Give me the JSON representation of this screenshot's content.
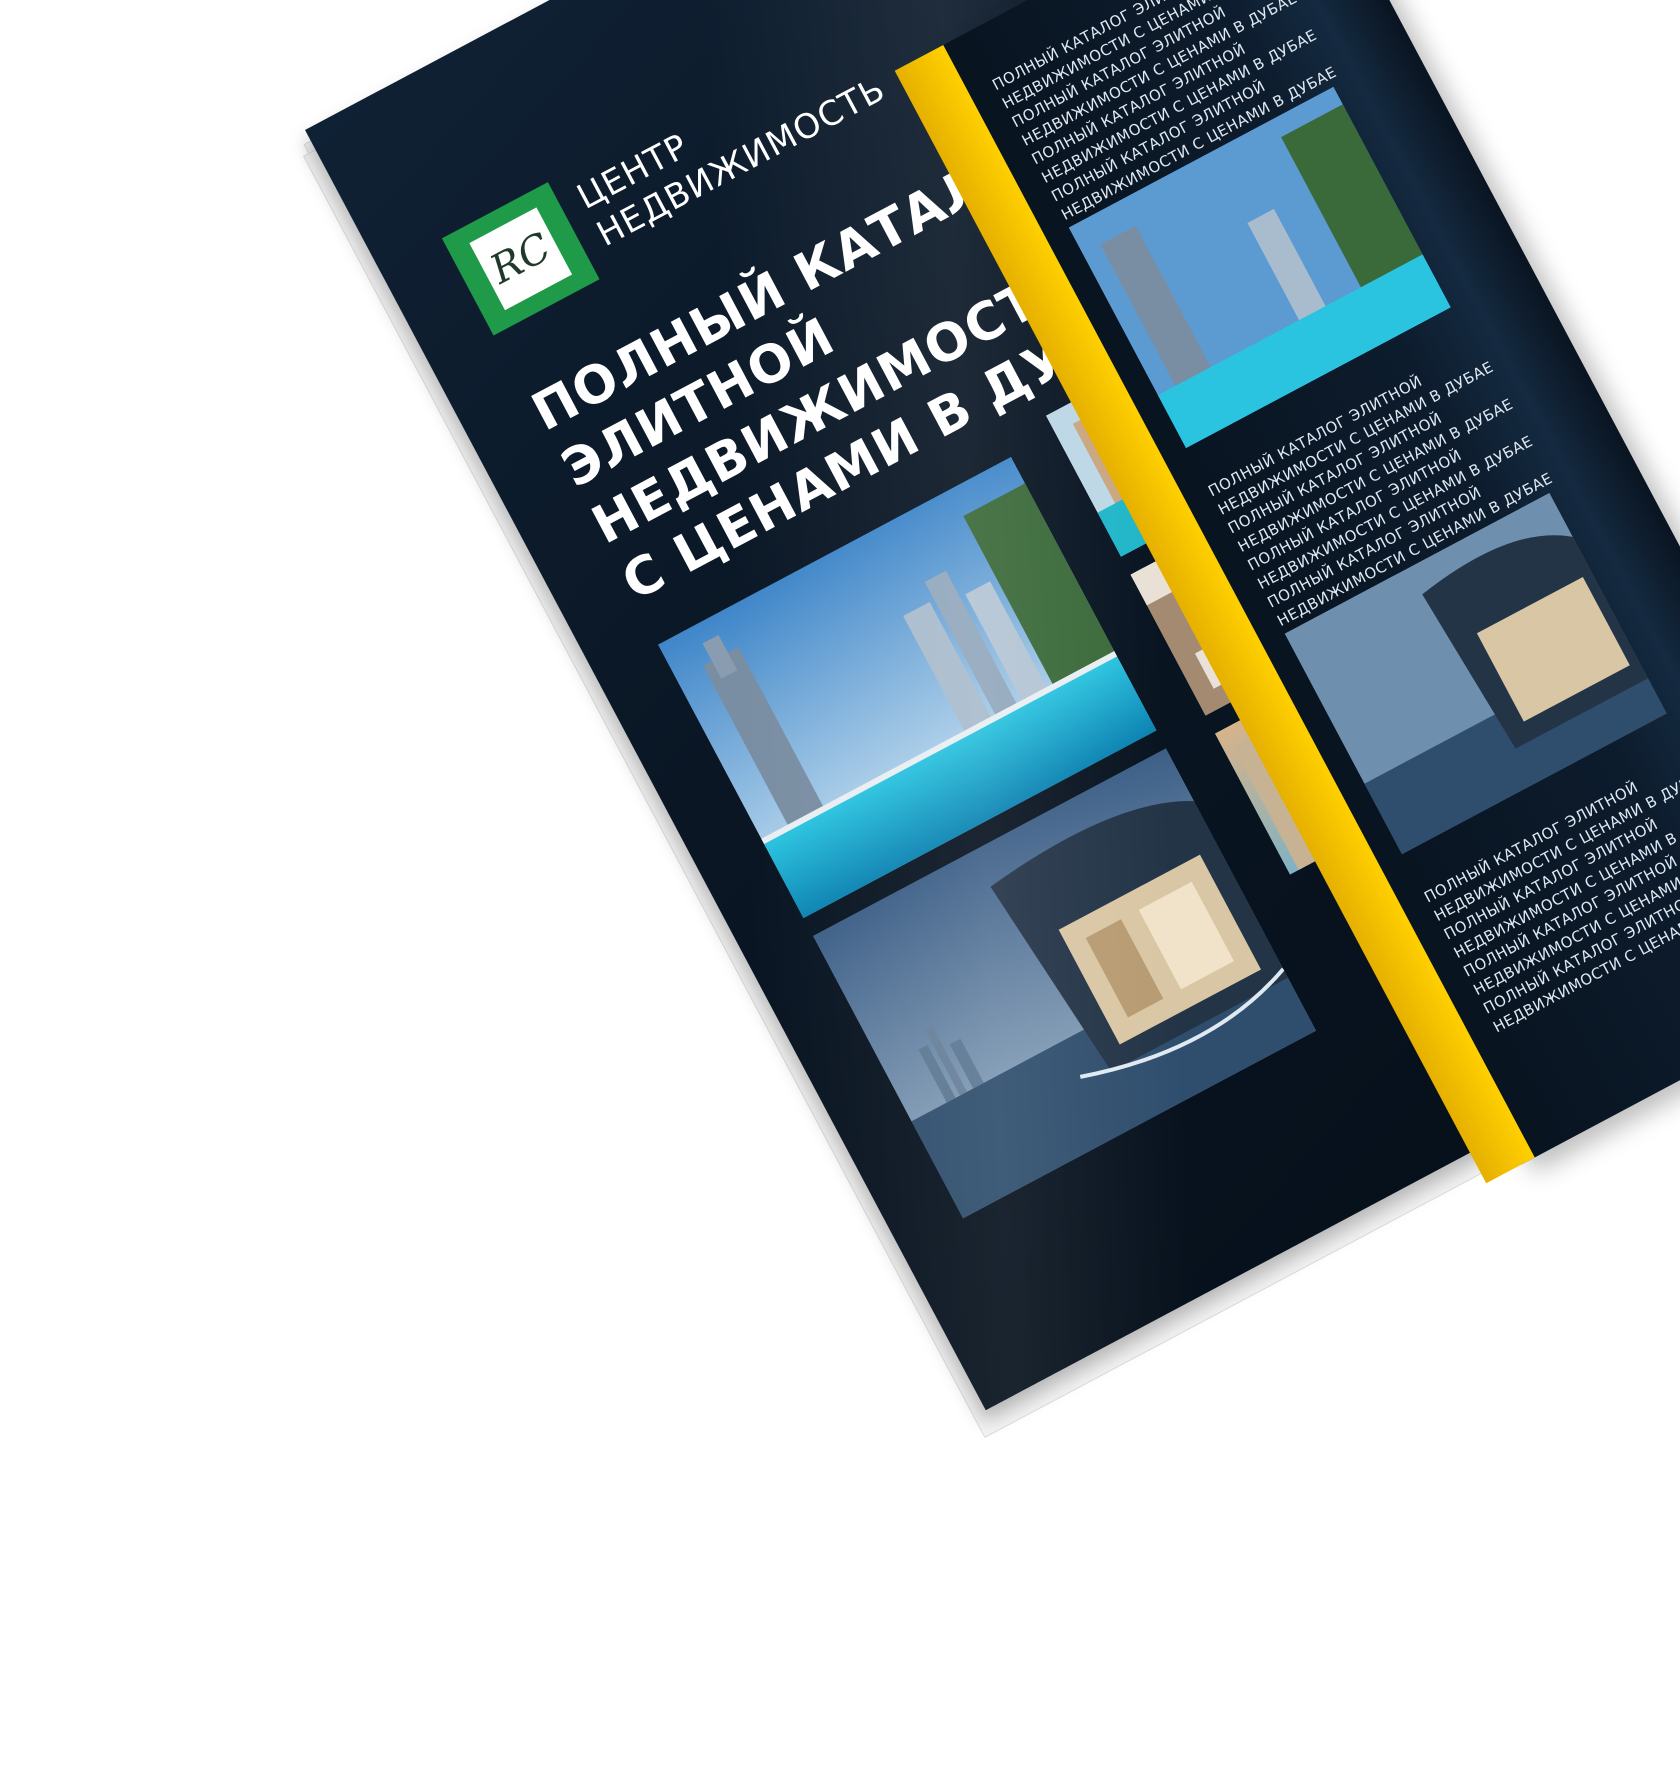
{
  "brand": {
    "logo_monogram": "RC",
    "name_line1": "ЦЕНТР",
    "name_line2": "НЕДВИЖИМОСТЬ"
  },
  "headline": {
    "line1": "ПОЛНЫЙ КАТАЛОГ",
    "line2": "ЭЛИТНОЙ НЕДВИЖИМОСТИ",
    "line3": "С ЦЕНАМИ В ДУБАЕ"
  },
  "right_page": {
    "paragraphs": [
      "ПОЛНЫЙ КАТАЛОГ ЭЛИТНОЙ НЕДВИЖИМОСТИ С ЦЕНАМИ В ДУБАЕ ПОЛНЫЙ КАТАЛОГ ЭЛИТНОЙ НЕДВИЖИМОСТИ С ЦЕНАМИ В ДУБАЕ ПОЛНЫЙ КАТАЛОГ ЭЛИТНОЙ НЕДВИЖИМОСТИ С ЦЕНАМИ В ДУБАЕ ПОЛНЫЙ КАТАЛОГ ЭЛИТНОЙ НЕДВИЖИМОСТИ С ЦЕНАМИ В ДУБАЕ",
      "ПОЛНЫЙ КАТАЛОГ ЭЛИТНОЙ НЕДВИЖИМОСТИ С ЦЕНАМИ В ДУБАЕ ПОЛНЫЙ КАТАЛОГ ЭЛИТНОЙ НЕДВИЖИМОСТИ С ЦЕНАМИ В ДУБАЕ ПОЛНЫЙ КАТАЛОГ ЭЛИТНОЙ НЕДВИЖИМОСТИ С ЦЕНАМИ В ДУБАЕ ПОЛНЫЙ КАТАЛОГ ЭЛИТНОЙ НЕДВИЖИМОСТИ С ЦЕНАМИ В ДУБАЕ",
      "ПОЛНЫЙ КАТАЛОГ ЭЛИТНОЙ НЕДВИЖИМОСТИ С ЦЕНАМИ В ДУБАЕ ПОЛНЫЙ КАТАЛОГ ЭЛИТНОЙ НЕДВИЖИМОСТИ С ЦЕНАМИ В ДУБАЕ ПОЛНЫЙ КАТАЛОГ ЭЛИТНОЙ НЕДВИЖИМОСТИ С ЦЕНАМИ В ДУБАЕ ПОЛНЫЙ КАТАЛОГ ЭЛИТНОЙ НЕДВИЖИМОСТИ С ЦЕНАМИ В ДУБАЕ"
    ]
  },
  "colors": {
    "page_dark": "#0a1624",
    "accent_yellow": "#ffc400",
    "logo_green": "#1f9a48"
  }
}
